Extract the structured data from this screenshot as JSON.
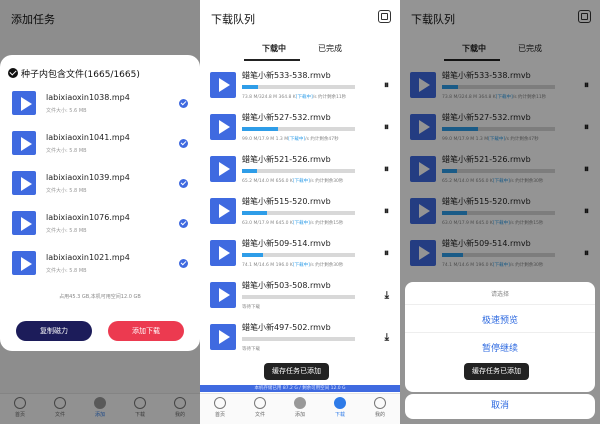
{
  "panel1": {
    "title": "添加任务",
    "dialog_title": "种子内包含文件(1665/1665)",
    "files": [
      {
        "name": "labixiaoxin1038.mp4",
        "size": "文件大小: 5.6 MB"
      },
      {
        "name": "labixiaoxin1041.mp4",
        "size": "文件大小: 5.8 MB"
      },
      {
        "name": "labixiaoxin1039.mp4",
        "size": "文件大小: 5.8 MB"
      },
      {
        "name": "labixiaoxin1076.mp4",
        "size": "文件大小: 5.8 MB"
      },
      {
        "name": "labixiaoxin1021.mp4",
        "size": "文件大小: 5.8 MB"
      }
    ],
    "space_text": "占用45.3 GB,本机可用空间12.0 GB",
    "copy_button": "复制磁力",
    "add_button": "添加下载"
  },
  "queue": {
    "title": "下载队列",
    "tab_downloading": "下载中",
    "tab_done": "已完成",
    "items": [
      {
        "name": "蜡笔小新533-538.rmvb",
        "progress": 0.14,
        "stat_a": "73.8 M/324.8 M 364.8 K",
        "stat_hl": "[下载中]",
        "stat_b": "/s 约计剩余11秒",
        "action": "pause"
      },
      {
        "name": "蜡笔小新527-532.rmvb",
        "progress": 0.32,
        "stat_a": "99.0 M/17.9 M 1.3 M",
        "stat_hl": "[下载中]",
        "stat_b": "/s 约计剩余47秒",
        "action": "pause"
      },
      {
        "name": "蜡笔小新521-526.rmvb",
        "progress": 0.13,
        "stat_a": "65.2 M/14.0 M 656.0 K",
        "stat_hl": "[下载中]",
        "stat_b": "/s 约计剩余30秒",
        "action": "pause"
      },
      {
        "name": "蜡笔小新515-520.rmvb",
        "progress": 0.22,
        "stat_a": "63.0 M/17.9 M 645.0 K",
        "stat_hl": "[下载中]",
        "stat_b": "/s 约计剩余15秒",
        "action": "pause"
      },
      {
        "name": "蜡笔小新509-514.rmvb",
        "progress": 0.19,
        "stat_a": "74.1 M/14.6 M 196.0 K",
        "stat_hl": "[下载中]",
        "stat_b": "/s 约计剩余30秒",
        "action": "pause"
      },
      {
        "name": "蜡笔小新503-508.rmvb",
        "progress": 0.0,
        "stat_a": "等待下载",
        "stat_hl": "",
        "stat_b": "",
        "action": "download"
      },
      {
        "name": "蜡笔小新497-502.rmvb",
        "progress": 0.0,
        "stat_a": "等待下载",
        "stat_hl": "",
        "stat_b": "",
        "action": "download"
      }
    ],
    "storage_text": "本机存储已用 87.2 G / 剩余可用空间 12.0 G",
    "toast": "缓存任务已添加"
  },
  "nav": [
    {
      "label": "首页",
      "name": "nav-home"
    },
    {
      "label": "文件",
      "name": "nav-files"
    },
    {
      "label": "添加",
      "name": "nav-add"
    },
    {
      "label": "下载",
      "name": "nav-download"
    },
    {
      "label": "我的",
      "name": "nav-mine"
    }
  ],
  "sheet": {
    "title": "请选择",
    "option1": "极速预览",
    "option2": "暂停继续",
    "cancel": "取消"
  },
  "colors": {
    "accent": "#3f6ae0",
    "progress": "#2e9de8",
    "danger": "#ec3a50",
    "dark": "#1c1c5a"
  }
}
